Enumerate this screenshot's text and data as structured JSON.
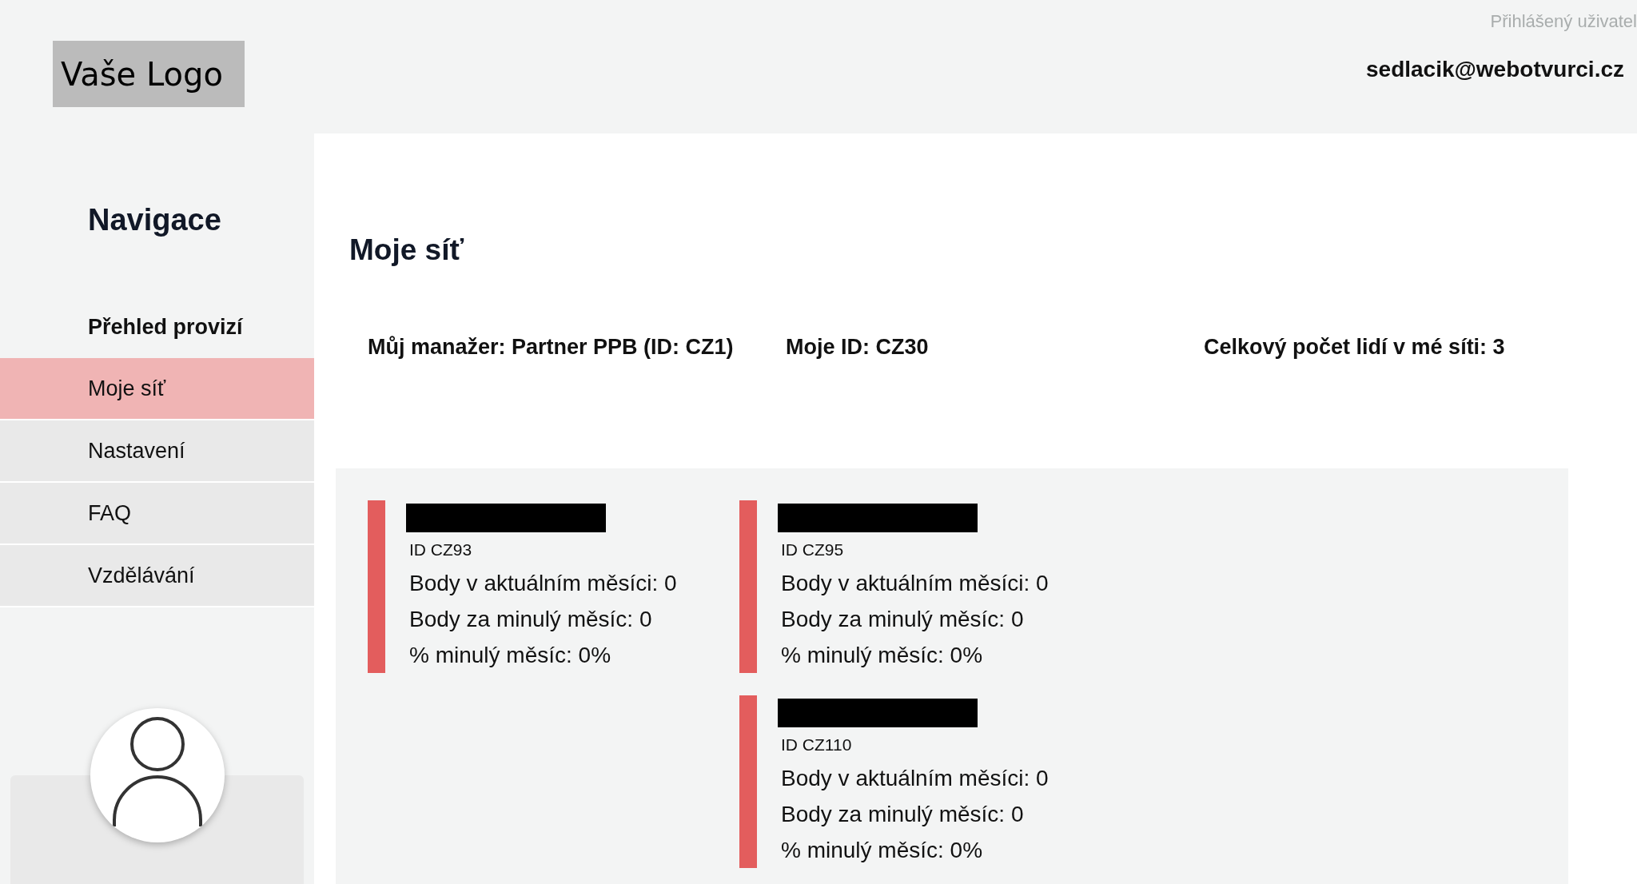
{
  "header": {
    "logo": "Vaše Logo",
    "user_label": "Přihlášený uživatel",
    "user_email": "sedlacik@webotvurci.cz"
  },
  "sidebar": {
    "title": "Navigace",
    "items": [
      {
        "label": "Přehled provizí",
        "kind": "plain",
        "selected": false
      },
      {
        "label": "Moje síť",
        "kind": "tile",
        "selected": true
      },
      {
        "label": "Nastavení",
        "kind": "tile",
        "selected": false
      },
      {
        "label": "FAQ",
        "kind": "tile",
        "selected": false
      },
      {
        "label": "Vzdělávání",
        "kind": "tile",
        "selected": false
      }
    ]
  },
  "page": {
    "title": "Moje síť",
    "summary": [
      "Můj manažer: Partner PPB (ID: CZ1)",
      "Moje ID: CZ30",
      "Celkový počet lidí v mé síti: 3"
    ],
    "network": [
      {
        "redacted": true,
        "id": "ID CZ93",
        "lines": [
          "Body v aktuálním měsíci: 0",
          "Body za minulý měsíc: 0",
          "% minulý měsíc: 0%"
        ],
        "children": [
          {
            "redacted": true,
            "id": "ID CZ95",
            "lines": [
              "Body v aktuálním měsíci: 0",
              "Body za minulý měsíc: 0",
              "% minulý měsíc: 0%"
            ]
          },
          {
            "redacted": true,
            "id": "ID CZ110",
            "lines": [
              "Body v aktuálním měsíci: 0",
              "Body za minulý měsíc: 0",
              "% minulý měsíc: 0%"
            ]
          }
        ]
      }
    ]
  }
}
